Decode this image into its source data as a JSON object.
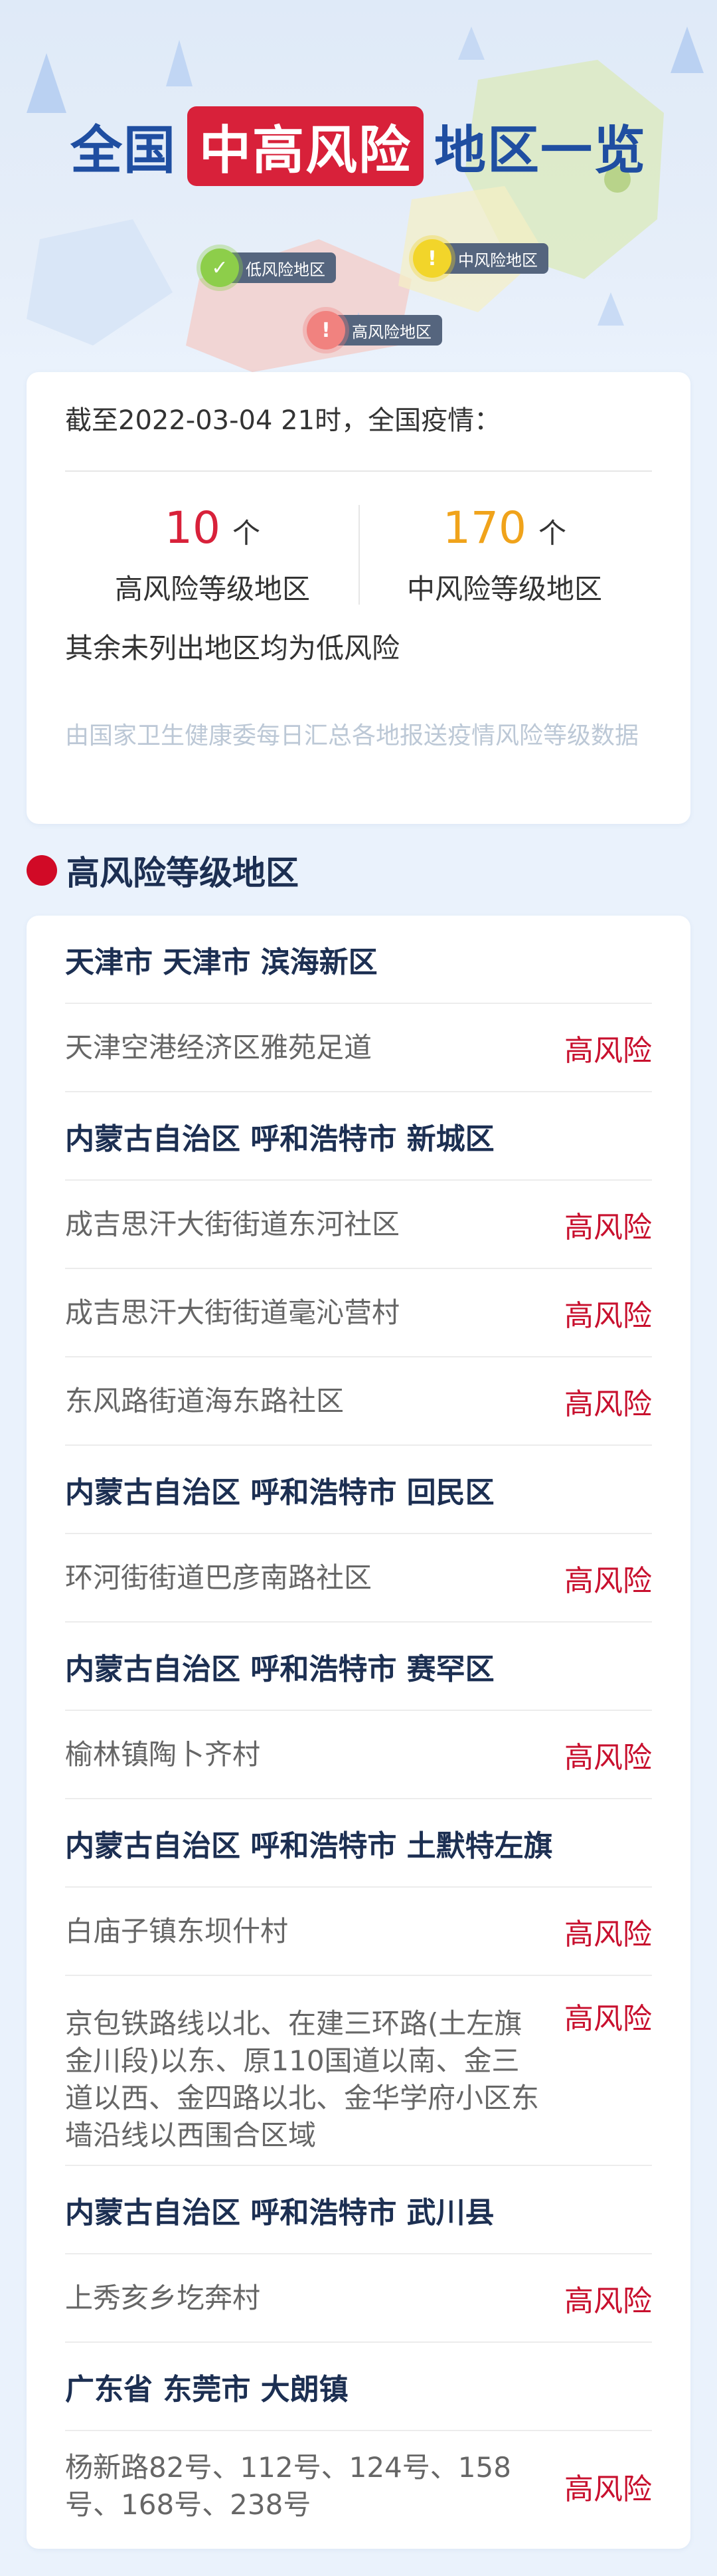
{
  "hero": {
    "title_pre": "全国",
    "title_highlight": "中高风险",
    "title_post": "地区一览",
    "legend": [
      {
        "label": "低风险地区",
        "icon": "check",
        "color": "#8dce4a"
      },
      {
        "label": "中风险地区",
        "icon": "!",
        "color": "#f2d52a"
      },
      {
        "label": "高风险地区",
        "icon": "!",
        "color": "#f1827f"
      }
    ]
  },
  "summary": {
    "asof": "截至2022-03-04 21时，全国疫情：",
    "high_count": "10",
    "high_unit": "个",
    "high_label": "高风险等级地区",
    "mid_count": "170",
    "mid_unit": "个",
    "mid_label": "中风险等级地区",
    "rest": "其余未列出地区均为低风险",
    "source": "由国家卫生健康委每日汇总各地报送疫情风险等级数据"
  },
  "section": {
    "title": "高风险等级地区"
  },
  "list": [
    {
      "type": "region",
      "name": "天津市 天津市 滨海新区"
    },
    {
      "type": "place",
      "name": "天津空港经济区雅苑足道",
      "risk": "高风险"
    },
    {
      "type": "region",
      "name": "内蒙古自治区 呼和浩特市 新城区"
    },
    {
      "type": "place",
      "name": "成吉思汗大街街道东河社区",
      "risk": "高风险"
    },
    {
      "type": "place",
      "name": "成吉思汗大街街道毫沁营村",
      "risk": "高风险"
    },
    {
      "type": "place",
      "name": "东风路街道海东路社区",
      "risk": "高风险"
    },
    {
      "type": "region",
      "name": "内蒙古自治区 呼和浩特市 回民区"
    },
    {
      "type": "place",
      "name": "环河街街道巴彦南路社区",
      "risk": "高风险"
    },
    {
      "type": "region",
      "name": "内蒙古自治区 呼和浩特市 赛罕区"
    },
    {
      "type": "place",
      "name": "榆林镇陶卜齐村",
      "risk": "高风险"
    },
    {
      "type": "region",
      "name": "内蒙古自治区 呼和浩特市 土默特左旗"
    },
    {
      "type": "place",
      "name": "白庙子镇东坝什村",
      "risk": "高风险"
    },
    {
      "type": "place",
      "name": "京包铁路线以北、在建三环路(土左旗金川段)以东、原110国道以南、金三道以西、金四路以北、金华学府小区东墙沿线以西围合区域",
      "risk": "高风险"
    },
    {
      "type": "region",
      "name": "内蒙古自治区 呼和浩特市 武川县"
    },
    {
      "type": "place",
      "name": "上秀亥乡圪奔村",
      "risk": "高风险"
    },
    {
      "type": "region",
      "name": "广东省 东莞市 大朗镇"
    },
    {
      "type": "place",
      "name": "杨新路82号、112号、124号、158号、168号、238号",
      "risk": "高风险"
    }
  ]
}
